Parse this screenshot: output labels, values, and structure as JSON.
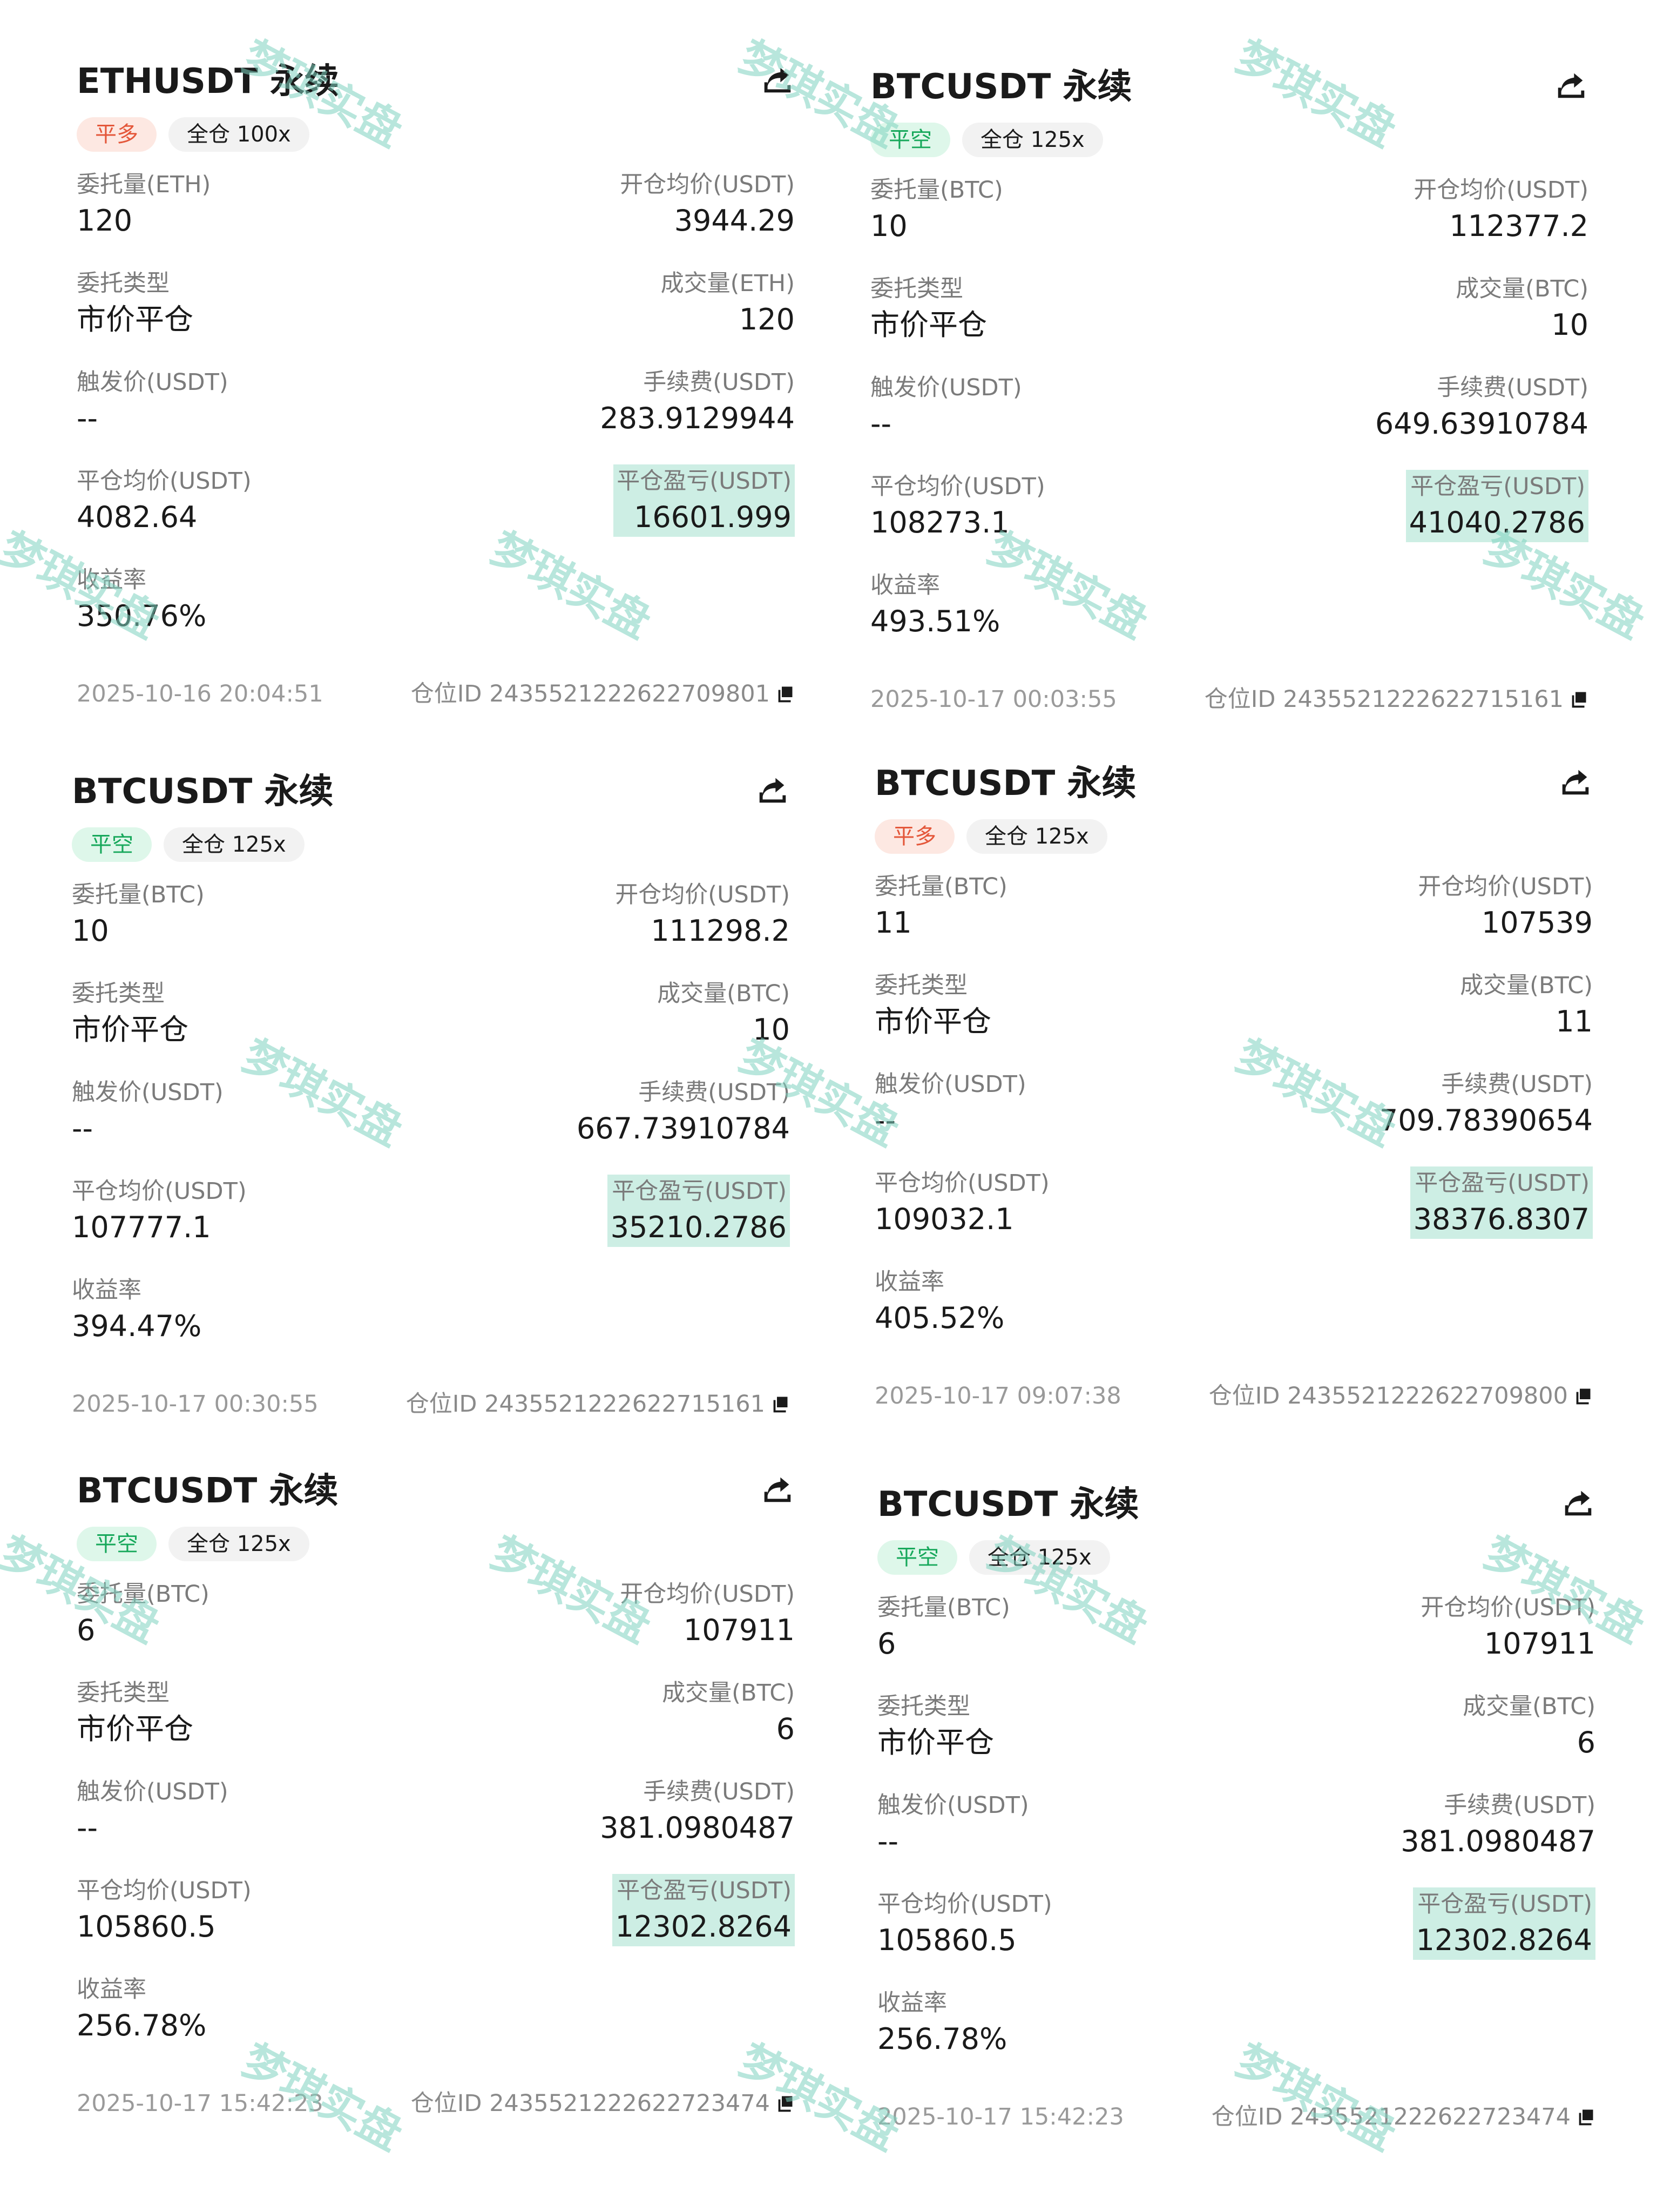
{
  "watermark": "梦琪实盘",
  "cards": [
    {
      "title": "ETHUSDT 永续",
      "side": "平多",
      "margin": "全仓 100x",
      "order_qty_label": "委托量(ETH)",
      "order_qty": "120",
      "open_avg_label": "开仓均价(USDT)",
      "open_avg": "3944.29",
      "order_type_label": "委托类型",
      "order_type": "市价平仓",
      "filled_label": "成交量(ETH)",
      "filled": "120",
      "trigger_label": "触发价(USDT)",
      "trigger": "--",
      "fee_label": "手续费(USDT)",
      "fee": "283.9129944",
      "close_avg_label": "平仓均价(USDT)",
      "close_avg": "4082.64",
      "pnl_label": "平仓盈亏(USDT)",
      "pnl": "16601.999",
      "roi_label": "收益率",
      "roi": "350.76%",
      "time": "2025-10-16 20:04:51",
      "position_id": "仓位ID 2435521222622709801"
    },
    {
      "title": "BTCUSDT 永续",
      "side": "平空",
      "margin": "全仓 125x",
      "order_qty_label": "委托量(BTC)",
      "order_qty": "10",
      "open_avg_label": "开仓均价(USDT)",
      "open_avg": "112377.2",
      "order_type_label": "委托类型",
      "order_type": "市价平仓",
      "filled_label": "成交量(BTC)",
      "filled": "10",
      "trigger_label": "触发价(USDT)",
      "trigger": "--",
      "fee_label": "手续费(USDT)",
      "fee": "649.63910784",
      "close_avg_label": "平仓均价(USDT)",
      "close_avg": "108273.1",
      "pnl_label": "平仓盈亏(USDT)",
      "pnl": "41040.2786",
      "roi_label": "收益率",
      "roi": "493.51%",
      "time": "2025-10-17 00:03:55",
      "position_id": "仓位ID 2435521222622715161"
    },
    {
      "title": "BTCUSDT 永续",
      "side": "平空",
      "margin": "全仓 125x",
      "order_qty_label": "委托量(BTC)",
      "order_qty": "10",
      "open_avg_label": "开仓均价(USDT)",
      "open_avg": "111298.2",
      "order_type_label": "委托类型",
      "order_type": "市价平仓",
      "filled_label": "成交量(BTC)",
      "filled": "10",
      "trigger_label": "触发价(USDT)",
      "trigger": "--",
      "fee_label": "手续费(USDT)",
      "fee": "667.73910784",
      "close_avg_label": "平仓均价(USDT)",
      "close_avg": "107777.1",
      "pnl_label": "平仓盈亏(USDT)",
      "pnl": "35210.2786",
      "roi_label": "收益率",
      "roi": "394.47%",
      "time": "2025-10-17 00:30:55",
      "position_id": "仓位ID 2435521222622715161"
    },
    {
      "title": "BTCUSDT 永续",
      "side": "平多",
      "margin": "全仓 125x",
      "order_qty_label": "委托量(BTC)",
      "order_qty": "11",
      "open_avg_label": "开仓均价(USDT)",
      "open_avg": "107539",
      "order_type_label": "委托类型",
      "order_type": "市价平仓",
      "filled_label": "成交量(BTC)",
      "filled": "11",
      "trigger_label": "触发价(USDT)",
      "trigger": "--",
      "fee_label": "手续费(USDT)",
      "fee": "709.78390654",
      "close_avg_label": "平仓均价(USDT)",
      "close_avg": "109032.1",
      "pnl_label": "平仓盈亏(USDT)",
      "pnl": "38376.8307",
      "roi_label": "收益率",
      "roi": "405.52%",
      "time": "2025-10-17 09:07:38",
      "position_id": "仓位ID 2435521222622709800"
    },
    {
      "title": "BTCUSDT 永续",
      "side": "平空",
      "margin": "全仓 125x",
      "order_qty_label": "委托量(BTC)",
      "order_qty": "6",
      "open_avg_label": "开仓均价(USDT)",
      "open_avg": "107911",
      "order_type_label": "委托类型",
      "order_type": "市价平仓",
      "filled_label": "成交量(BTC)",
      "filled": "6",
      "trigger_label": "触发价(USDT)",
      "trigger": "--",
      "fee_label": "手续费(USDT)",
      "fee": "381.0980487",
      "close_avg_label": "平仓均价(USDT)",
      "close_avg": "105860.5",
      "pnl_label": "平仓盈亏(USDT)",
      "pnl": "12302.8264",
      "roi_label": "收益率",
      "roi": "256.78%",
      "time": "2025-10-17 15:42:23",
      "position_id": "仓位ID 2435521222622723474"
    },
    {
      "title": "BTCUSDT 永续",
      "side": "平空",
      "margin": "全仓 125x",
      "order_qty_label": "委托量(BTC)",
      "order_qty": "6",
      "open_avg_label": "开仓均价(USDT)",
      "open_avg": "107911",
      "order_type_label": "委托类型",
      "order_type": "市价平仓",
      "filled_label": "成交量(BTC)",
      "filled": "6",
      "trigger_label": "触发价(USDT)",
      "trigger": "--",
      "fee_label": "手续费(USDT)",
      "fee": "381.0980487",
      "close_avg_label": "平仓均价(USDT)",
      "close_avg": "105860.5",
      "pnl_label": "平仓盈亏(USDT)",
      "pnl": "12302.8264",
      "roi_label": "收益率",
      "roi": "256.78%",
      "time": "2025-10-17 15:42:23",
      "position_id": "仓位ID 2435521222622723474"
    }
  ],
  "colors": {
    "close_long": "#e4573a",
    "close_long_bg": "#fde8e2",
    "close_short": "#17a85b",
    "close_short_bg": "#def7ea",
    "pnl_highlight": "#cdeee4",
    "watermark": "#7fd3c0"
  },
  "icons": {
    "share": "share-arrow-icon",
    "copy": "copy-icon"
  }
}
